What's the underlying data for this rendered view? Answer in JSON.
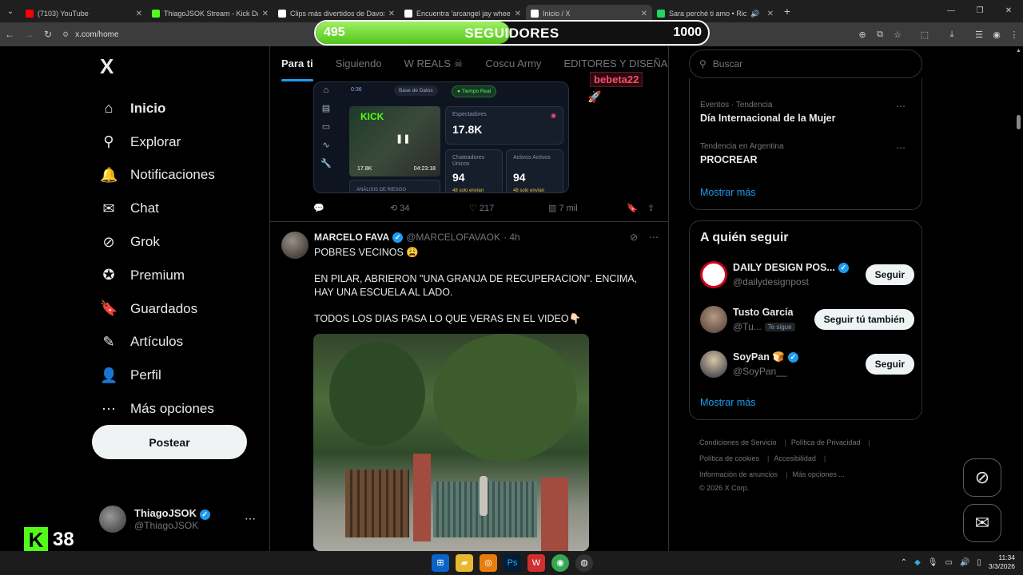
{
  "browser": {
    "tabs": [
      {
        "title": "(7103) YouTube",
        "color": "#ff0000",
        "active": false
      },
      {
        "title": "ThiagoJSOK Stream - Kick Dash",
        "color": "#53fc18",
        "active": false
      },
      {
        "title": "Clips más divertidos de Davoxen",
        "color": "#ffffff",
        "active": false
      },
      {
        "title": "Encuentra 'arcangel jay wheeler",
        "color": "#ffffff",
        "active": false
      },
      {
        "title": "Inicio / X",
        "color": "#ffffff",
        "active": true
      },
      {
        "title": "Sara perché ti amo • Ricchi",
        "color": "#1ed760",
        "active": false
      }
    ],
    "url": "x.com/home"
  },
  "overlay": {
    "current": "495",
    "label": "SEGUIDORES",
    "goal": "1000",
    "progress": 0.495
  },
  "sidebar": {
    "logo": "X",
    "items": [
      {
        "label": "Inicio",
        "icon": "home-icon",
        "glyph": "⌂"
      },
      {
        "label": "Explorar",
        "icon": "search-icon",
        "glyph": "⚲"
      },
      {
        "label": "Notificaciones",
        "icon": "bell-icon",
        "glyph": "🔔"
      },
      {
        "label": "Chat",
        "icon": "mail-icon",
        "glyph": "✉"
      },
      {
        "label": "Grok",
        "icon": "grok-icon",
        "glyph": "⊘"
      },
      {
        "label": "Premium",
        "icon": "premium-icon",
        "glyph": "✪"
      },
      {
        "label": "Guardados",
        "icon": "bookmark-icon",
        "glyph": "🔖"
      },
      {
        "label": "Artículos",
        "icon": "article-icon",
        "glyph": "✎"
      },
      {
        "label": "Perfil",
        "icon": "profile-icon",
        "glyph": "👤"
      },
      {
        "label": "Más opciones",
        "icon": "more-icon",
        "glyph": "⋯"
      }
    ],
    "post_label": "Postear",
    "user": {
      "name": "ThiagoJSOK",
      "handle": "@ThiagoJSOK"
    }
  },
  "kick": {
    "logo": "K",
    "number": "38"
  },
  "feed": {
    "tabs": [
      "Para ti",
      "Siguiendo",
      "W REALS ☠",
      "Coscu Army",
      "EDITORES Y DISEÑADOR"
    ],
    "dashboard": {
      "time": "0:36",
      "chip_db": "Base de Datos",
      "chip_live": "● Tiempo Real",
      "kick_label": "KICK",
      "viewers_small": "17.8K",
      "duration": "04:23:18",
      "spectators_label": "Espectadores",
      "spectators_value": "17.8K",
      "chatters_label": "Chateadores Únicos",
      "chatters_value": "94",
      "chatters_sub": "48 solo envían",
      "active_label": "Activos Activos",
      "active_value": "94",
      "active_sub": "48 solo envían",
      "risk_label": "ANÁLISIS DE RIESGO"
    },
    "bebeta": "bebeta22",
    "actions1": {
      "retweets": "34",
      "likes": "217",
      "views": "7 mil"
    },
    "post": {
      "name": "MARCELO FAVA",
      "handle": "@MARCELOFAVAOK",
      "time": "· 4h",
      "lines": [
        "POBRES VECINOS 😩",
        "EN PILAR, ABRIERON \"UNA GRANJA DE RECUPERACION\". ENCIMA, HAY UNA ESCUELA AL LADO.",
        "TODOS LOS DIAS PASA LO QUE VERAS EN EL VIDEO👇🏻"
      ]
    }
  },
  "right": {
    "search_placeholder": "Buscar",
    "trends": [
      {
        "meta": "Eventos · Tendencia",
        "name": "Día Internacional de la Mujer"
      },
      {
        "meta": "Tendencia en Argentina",
        "name": "PROCREAR"
      }
    ],
    "show_more": "Mostrar más",
    "follow_title": "A quién seguir",
    "follow": [
      {
        "name": "DAILY DESIGN POS...",
        "handle": "@dailydesignpost",
        "button": "Seguir",
        "badge": "",
        "verified": true
      },
      {
        "name": "Tusto García",
        "handle": "@Tu...",
        "button": "Seguir tú también",
        "badge": "Te sigue",
        "verified": false
      },
      {
        "name": "SoyPan 🍞",
        "handle": "@SoyPan__",
        "button": "Seguir",
        "badge": "",
        "verified": true
      }
    ],
    "follow_more": "Mostrar más",
    "footer": [
      "Condiciones de Servicio",
      "Política de Privacidad",
      "Política de cookies",
      "Accesibilidad",
      "Información de anuncios",
      "Más opciones ...",
      "© 2026 X Corp."
    ]
  },
  "taskbar": {
    "time": "11:34",
    "date": "3/3/2026"
  }
}
